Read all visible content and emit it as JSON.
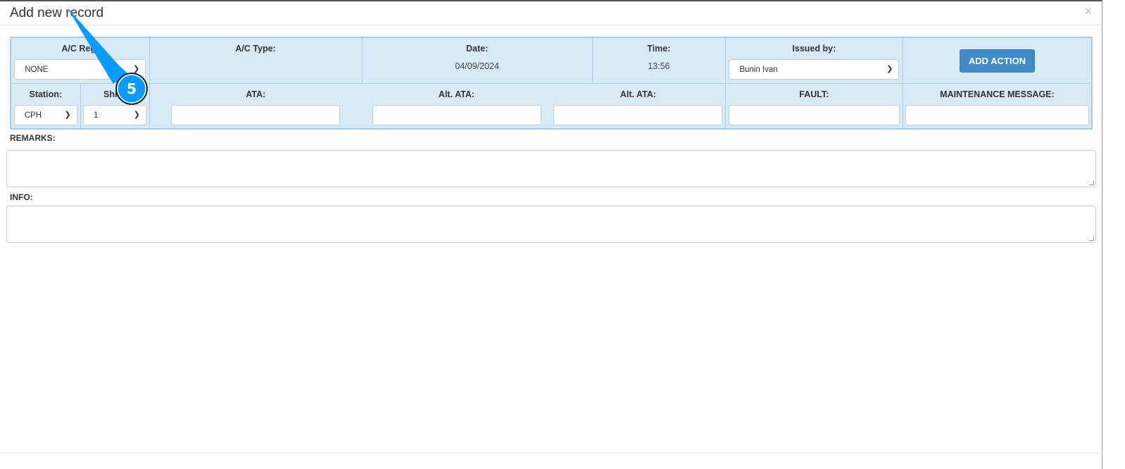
{
  "modal": {
    "title": "Add new record",
    "close": "×"
  },
  "row1": {
    "ac_reg": {
      "label": "A/C Reg:",
      "value": "NONE"
    },
    "ac_type": {
      "label": "A/C Type:"
    },
    "date": {
      "label": "Date:",
      "value": "04/09/2024"
    },
    "time": {
      "label": "Time:",
      "value": "13:56"
    },
    "issued_by": {
      "label": "Issued by:",
      "value": "Bunin Ivan"
    },
    "add_action": "ADD ACTION"
  },
  "row2": {
    "station": {
      "label": "Station:",
      "value": "CPH"
    },
    "shift": {
      "label": "Shift:",
      "value": "1"
    },
    "ata": {
      "label": "ATA:"
    },
    "alt_ata1": {
      "label": "Alt. ATA:"
    },
    "alt_ata2": {
      "label": "Alt. ATA:"
    },
    "fault": {
      "label": "FAULT:"
    },
    "maint": {
      "label": "MAINTENANCE MESSAGE:"
    }
  },
  "remarks": {
    "label": "REMARKS:"
  },
  "info": {
    "label": "INFO:"
  },
  "annotation": {
    "number": "5",
    "color": "#0a9bff"
  }
}
